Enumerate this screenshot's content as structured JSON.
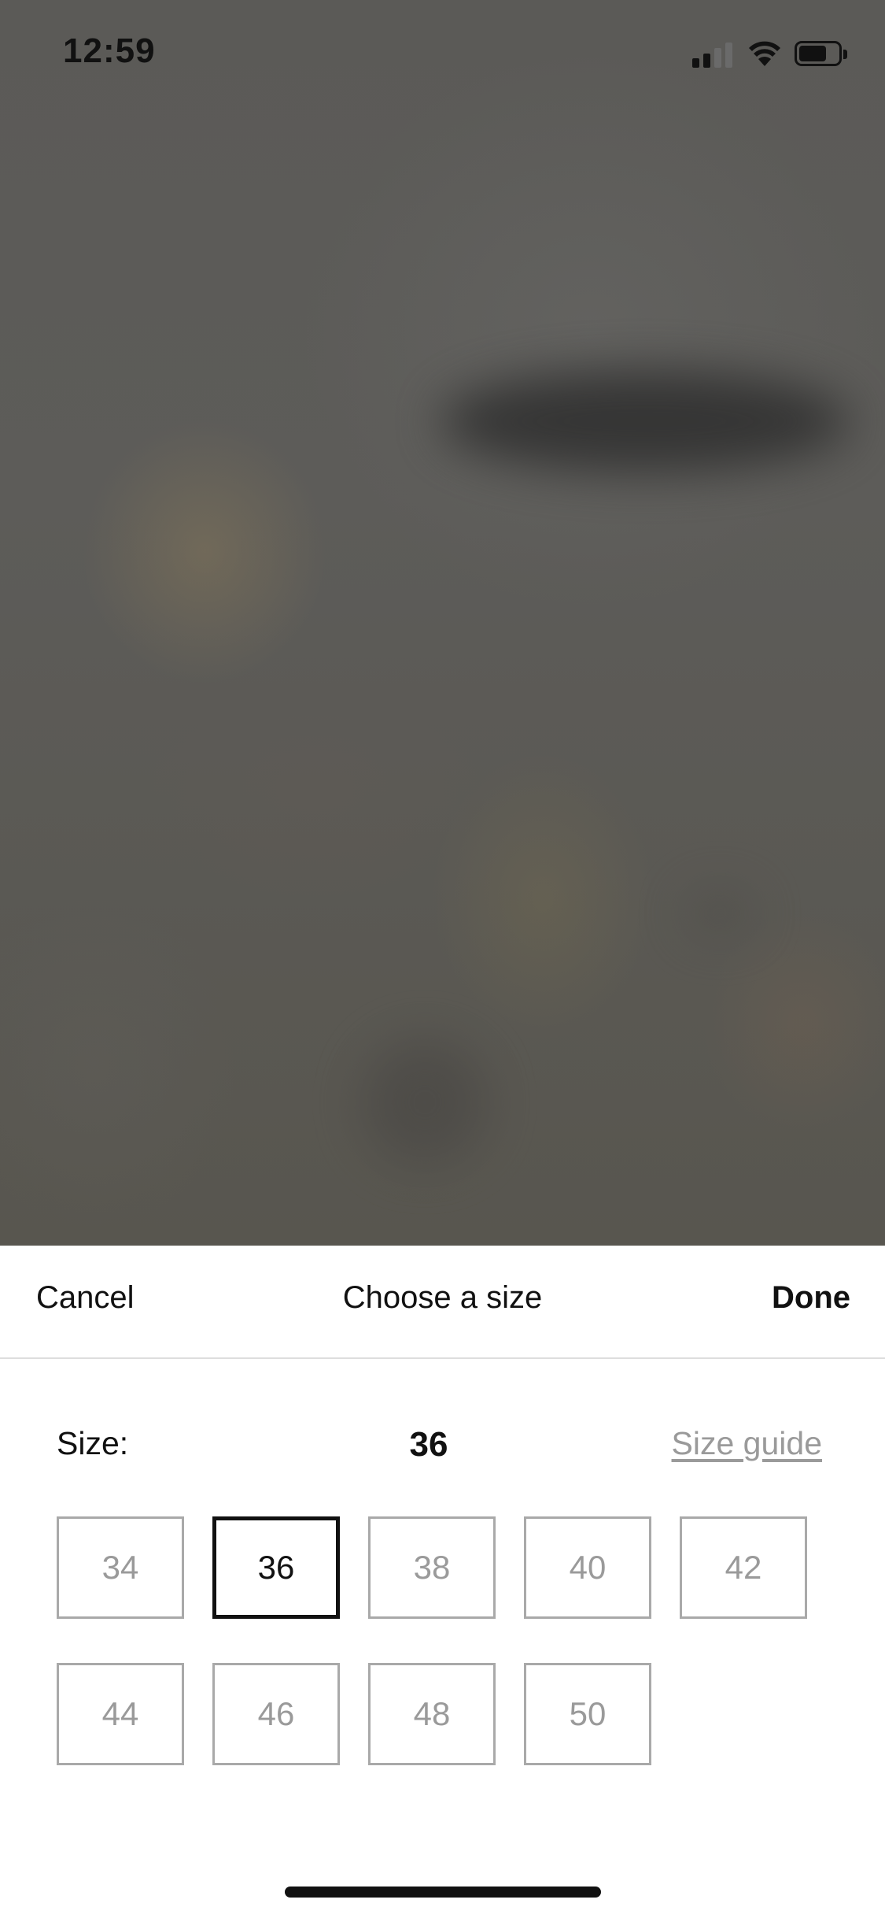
{
  "status_bar": {
    "time": "12:59",
    "icons": [
      "signal-icon",
      "wifi-icon",
      "battery-icon"
    ]
  },
  "sheet": {
    "cancel_label": "Cancel",
    "title": "Choose a size",
    "done_label": "Done",
    "size_label": "Size:",
    "selected_size": "36",
    "size_guide_label": "Size guide",
    "options": [
      {
        "label": "34",
        "selected": false
      },
      {
        "label": "36",
        "selected": true
      },
      {
        "label": "38",
        "selected": false
      },
      {
        "label": "40",
        "selected": false
      },
      {
        "label": "42",
        "selected": false
      },
      {
        "label": "44",
        "selected": false
      },
      {
        "label": "46",
        "selected": false
      },
      {
        "label": "48",
        "selected": false
      },
      {
        "label": "50",
        "selected": false
      }
    ]
  },
  "colors": {
    "text_primary": "#111111",
    "text_muted": "#9a9a9a",
    "border_muted": "#a9a9a9",
    "sheet_background": "#ffffff",
    "backdrop": "#575552"
  }
}
